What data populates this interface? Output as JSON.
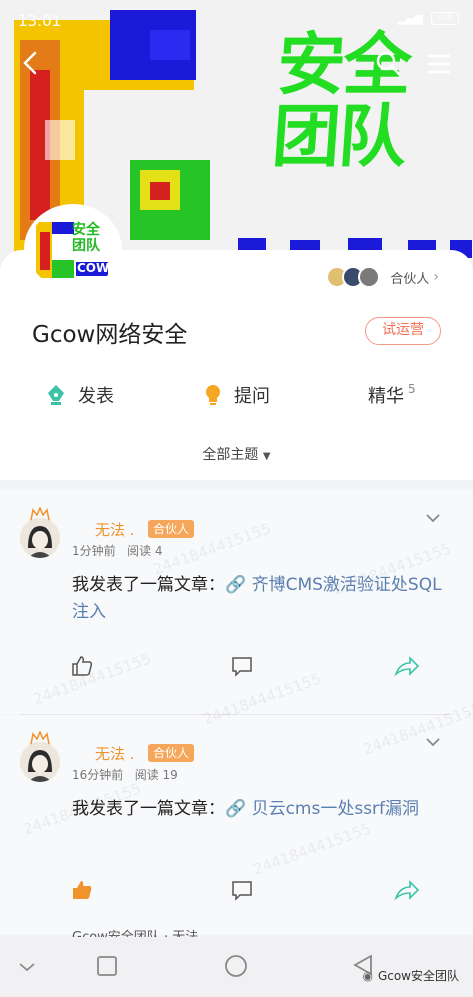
{
  "status_bar": {
    "time": "13:01",
    "battery": "100"
  },
  "banner": {
    "title_line1": "安全",
    "title_line2": "团队"
  },
  "group": {
    "logo_line1": "安全",
    "logo_line2": "团队",
    "logo_word": "COW",
    "partners_label": "合伙人",
    "name": "Gcow网络安全",
    "status_badge": "试运营",
    "actions": [
      {
        "label": "发表",
        "icon": "pen-nib-icon"
      },
      {
        "label": "提问",
        "icon": "lightbulb-icon"
      },
      {
        "label": "精华",
        "count": "5"
      }
    ],
    "topic_filter": "全部主题"
  },
  "posts": [
    {
      "author": "无法 .",
      "role_tag": "合伙人",
      "time": "1分钟前",
      "read": "阅读 4",
      "text": "我发表了一篇文章：",
      "link": "🔗 齐博CMS激活验证处SQL注入",
      "liked": false
    },
    {
      "author": "无法 .",
      "role_tag": "合伙人",
      "time": "16分钟前",
      "read": "阅读 19",
      "text": "我发表了一篇文章：",
      "link": "🔗 贝云cms一处ssrf漏洞",
      "liked": true
    }
  ],
  "peek_text": "Gcow安全团队 · 无法",
  "watermark": "2441844415155",
  "wechat_tag": "Gcow安全团队",
  "colors": {
    "accent_orange": "#f0932b",
    "tag_orange": "#f5a65b",
    "link_blue": "#5b7fb0",
    "share_teal": "#3cc3a6",
    "badge_red": "#f07055"
  }
}
